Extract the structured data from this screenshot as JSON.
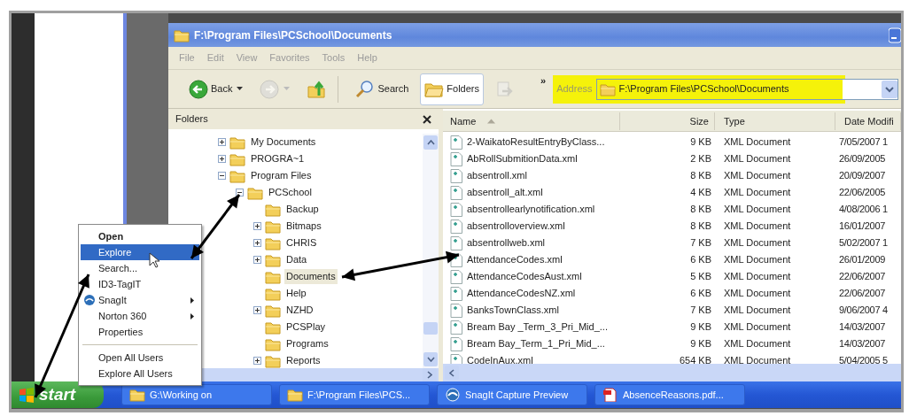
{
  "window": {
    "title": "F:\\Program Files\\PCSchool\\Documents"
  },
  "menu": [
    "File",
    "Edit",
    "View",
    "Favorites",
    "Tools",
    "Help"
  ],
  "toolbar": {
    "buttons": [
      {
        "kind": "back",
        "label": "Back",
        "disabled": false,
        "selected": false
      },
      {
        "kind": "forward",
        "disabled": true,
        "selected": false
      },
      {
        "kind": "up",
        "disabled": false,
        "selected": false
      },
      {
        "kind": "search",
        "label": "Search",
        "disabled": false,
        "selected": false
      },
      {
        "kind": "folders",
        "label": "Folders",
        "disabled": false,
        "selected": true
      },
      {
        "kind": "sync",
        "disabled": true,
        "selected": false
      }
    ],
    "overflow": "»",
    "address": {
      "label": "Address",
      "value": "F:\\Program Files\\PCSchool\\Documents",
      "highlighted": true
    }
  },
  "folders_pane": {
    "title": "Folders"
  },
  "tree": [
    {
      "kind": "expandable",
      "label": "My Documents",
      "expanded": false,
      "selected": false
    },
    {
      "kind": "expandable",
      "label": "PROGRA~1",
      "expanded": false,
      "selected": false
    },
    {
      "kind": "expandable",
      "label": "Program Files",
      "expanded": true,
      "selected": false,
      "children": [
        {
          "kind": "expandable",
          "label": "PCSchool",
          "expanded": true,
          "selected": false,
          "children": [
            {
              "kind": "leaf",
              "label": "Backup",
              "selected": false
            },
            {
              "kind": "expandable",
              "label": "Bitmaps",
              "expanded": false,
              "selected": false
            },
            {
              "kind": "expandable",
              "label": "CHRIS",
              "expanded": false,
              "selected": false
            },
            {
              "kind": "expandable",
              "label": "Data",
              "expanded": false,
              "selected": false
            },
            {
              "kind": "leaf",
              "label": "Documents",
              "selected": true
            },
            {
              "kind": "leaf",
              "label": "Help",
              "selected": false
            },
            {
              "kind": "expandable",
              "label": "NZHD",
              "expanded": false,
              "selected": false
            },
            {
              "kind": "leaf",
              "label": "PCSPlay",
              "selected": false
            },
            {
              "kind": "leaf",
              "label": "Programs",
              "selected": false
            },
            {
              "kind": "expandable",
              "label": "Reports",
              "expanded": false,
              "selected": false
            }
          ]
        }
      ]
    }
  ],
  "file_list": {
    "columns": [
      {
        "label": "Name",
        "sorted": true
      },
      {
        "label": "Size",
        "sorted": false
      },
      {
        "label": "Type",
        "sorted": false
      },
      {
        "label": "Date Modifi",
        "sorted": false
      }
    ],
    "rows": [
      {
        "name": "2-WaikatoResultEntryByClass...",
        "size": "9 KB",
        "type": "XML Document",
        "date": "7/05/2007 1"
      },
      {
        "name": "AbRollSubmitionData.xml",
        "size": "2 KB",
        "type": "XML Document",
        "date": "26/09/2005"
      },
      {
        "name": "absentroll.xml",
        "size": "8 KB",
        "type": "XML Document",
        "date": "20/09/2007"
      },
      {
        "name": "absentroll_alt.xml",
        "size": "4 KB",
        "type": "XML Document",
        "date": "22/06/2005"
      },
      {
        "name": "absentrollearlynotification.xml",
        "size": "8 KB",
        "type": "XML Document",
        "date": "4/08/2006 1"
      },
      {
        "name": "absentrolloverview.xml",
        "size": "8 KB",
        "type": "XML Document",
        "date": "16/01/2007"
      },
      {
        "name": "absentrollweb.xml",
        "size": "7 KB",
        "type": "XML Document",
        "date": "5/02/2007 1"
      },
      {
        "name": "AttendanceCodes.xml",
        "size": "6 KB",
        "type": "XML Document",
        "date": "26/01/2009"
      },
      {
        "name": "AttendanceCodesAust.xml",
        "size": "5 KB",
        "type": "XML Document",
        "date": "22/06/2007"
      },
      {
        "name": "AttendanceCodesNZ.xml",
        "size": "6 KB",
        "type": "XML Document",
        "date": "22/06/2007"
      },
      {
        "name": "BanksTownClass.xml",
        "size": "7 KB",
        "type": "XML Document",
        "date": "9/06/2007 4"
      },
      {
        "name": "Bream Bay _Term_3_Pri_Mid_...",
        "size": "9 KB",
        "type": "XML Document",
        "date": "14/03/2007"
      },
      {
        "name": "Bream Bay_Term_1_Pri_Mid_...",
        "size": "9 KB",
        "type": "XML Document",
        "date": "14/03/2007"
      },
      {
        "name": "CodeInAux.xml",
        "size": "654 KB",
        "type": "XML Document",
        "date": "5/04/2005 5"
      }
    ]
  },
  "context_menu": {
    "items": [
      {
        "kind": "item",
        "label": "Open",
        "default": true,
        "selected": false,
        "submenu": false
      },
      {
        "kind": "item",
        "label": "Explore",
        "default": false,
        "selected": true,
        "submenu": false
      },
      {
        "kind": "item",
        "label": "Search...",
        "default": false,
        "selected": false,
        "submenu": false
      },
      {
        "kind": "item",
        "label": "ID3-TagIT",
        "default": false,
        "selected": false,
        "submenu": false
      },
      {
        "kind": "app",
        "label": "SnagIt",
        "default": false,
        "selected": false,
        "submenu": true
      },
      {
        "kind": "item",
        "label": "Norton 360",
        "default": false,
        "selected": false,
        "submenu": true
      },
      {
        "kind": "item",
        "label": "Properties",
        "default": false,
        "selected": false,
        "submenu": false
      },
      {
        "kind": "separator"
      },
      {
        "kind": "item",
        "label": "Open All Users",
        "default": false,
        "selected": false,
        "submenu": false
      },
      {
        "kind": "item",
        "label": "Explore All Users",
        "default": false,
        "selected": false,
        "submenu": false
      }
    ]
  },
  "taskbar": {
    "start": "start",
    "tasks": [
      {
        "kind": "folder",
        "label": "G:\\Working on"
      },
      {
        "kind": "folder",
        "label": "F:\\Program Files\\PCS..."
      },
      {
        "kind": "snagit",
        "label": "SnagIt Capture Preview"
      },
      {
        "kind": "pdf",
        "label": "AbsenceReasons.pdf..."
      }
    ]
  }
}
